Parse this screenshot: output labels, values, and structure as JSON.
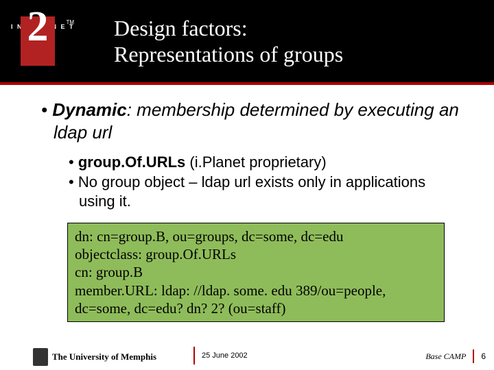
{
  "header": {
    "logo_digit": "2",
    "logo_word_left": "I N T E R N E T",
    "logo_tm": "TM",
    "title_line1": "Design factors:",
    "title_line2": "Representations of groups"
  },
  "content": {
    "main_bullet_prefix": "• ",
    "main_bullet_label": "Dynamic",
    "main_bullet_rest": ": membership determined by executing an ldap url",
    "sub1_prefix": "• ",
    "sub1_term": "group.Of.URLs",
    "sub1_rest": " (i.Planet proprietary)",
    "sub2": "• No group object – ldap url exists only in applications using it.",
    "code": {
      "l1": "dn: cn=group.B, ou=groups, dc=some, dc=edu",
      "l2": "objectclass: group.Of.URLs",
      "l3": "cn: group.B",
      "l4": "member.URL: ldap: //ldap. some. edu 389/ou=people,",
      "l5": " dc=some, dc=edu? dn? 2? (ou=staff)"
    }
  },
  "footer": {
    "university": "The University of Memphis",
    "date": "25 June 2002",
    "event": "Base CAMP",
    "page": "6"
  }
}
